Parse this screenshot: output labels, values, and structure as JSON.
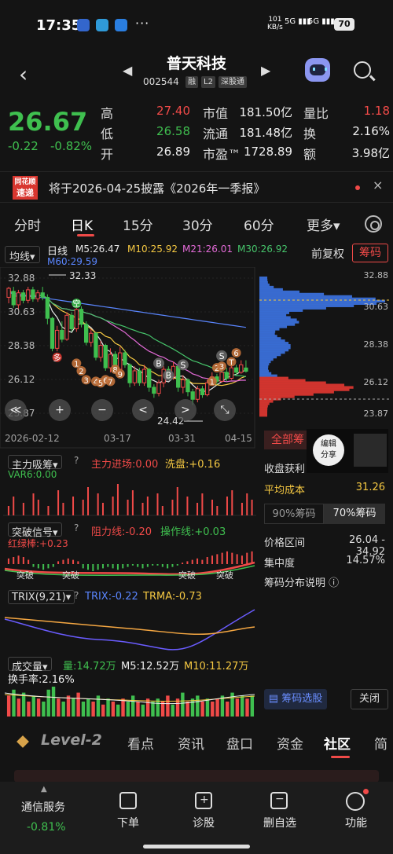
{
  "status_bar": {
    "time": "17:35",
    "dots": "···",
    "net_speed": "101",
    "net_unit": "KB/s",
    "sig1": "5G",
    "sig2": "5G",
    "battery": "70"
  },
  "header": {
    "name": "普天科技",
    "code": "002544",
    "tags": [
      "融",
      "L2",
      "深股通"
    ]
  },
  "quote": {
    "price": "26.67",
    "change": "-0.22",
    "change_pct": "-0.82%",
    "rows": [
      {
        "label1": "高",
        "value1": "27.40",
        "label2": "市值",
        "value2": "181.50亿",
        "label3": "量比",
        "value3": "1.18"
      },
      {
        "label1": "低",
        "value1": "26.58",
        "label2": "流通",
        "value2": "181.48亿",
        "label3": "换",
        "value3": "2.16%"
      },
      {
        "label1": "开",
        "value1": "26.89",
        "label2": "市盈™",
        "value2": "1728.89",
        "label3": "额",
        "value3": "3.98亿"
      }
    ]
  },
  "banner": {
    "logo_line1": "同花顺",
    "logo_line2": "速递",
    "text": "将于2026-04-25披露《2026年一季报》",
    "close": "×"
  },
  "tabs": [
    "分时",
    "日K",
    "15分",
    "30分",
    "60分",
    "更多▾"
  ],
  "chart_header": {
    "select": "均线▾",
    "period": "日线",
    "ma5": "M5:26.47",
    "ma10": "M10:25.92",
    "ma21": "M21:26.01",
    "ma30": "M30:26.92",
    "ma60": "M60:29.59",
    "fq_button": "前复权",
    "chip_button": "筹码"
  },
  "colors": {
    "up": "#f04a48",
    "down": "#3fbf4f",
    "ma5": "#e8e8e8",
    "ma10": "#f5c842",
    "ma21": "#e46bd8",
    "ma30": "#46c46b",
    "ma60": "#5a86ff"
  },
  "chart_data": {
    "type": "candlestick",
    "yticks": [
      "32.88",
      "30.63",
      "28.38",
      "26.12",
      "23.87"
    ],
    "ylim": [
      23.87,
      32.88
    ],
    "x_labels": [
      "2026-02-12",
      "03-17",
      "03-31",
      "04-15"
    ],
    "high_annotation": "32.33",
    "low_annotation": "24.42",
    "candles": [
      [
        31.6,
        32.2,
        31.2,
        32.3
      ],
      [
        32.0,
        31.1,
        30.9,
        32.3
      ],
      [
        31.1,
        31.9,
        30.8,
        32.1
      ],
      [
        31.9,
        31.4,
        31.2,
        32.1
      ],
      [
        31.4,
        32.1,
        31.2,
        32.3
      ],
      [
        32.1,
        31.5,
        31.3,
        32.3
      ],
      [
        31.5,
        31.9,
        31.3,
        32.1
      ],
      [
        31.9,
        31.6,
        31.4,
        32.3
      ],
      [
        31.6,
        30.2,
        29.8,
        31.8
      ],
      [
        30.2,
        28.2,
        28.0,
        30.3
      ],
      [
        28.2,
        29.4,
        28.0,
        29.7
      ],
      [
        29.4,
        28.8,
        28.6,
        30.0
      ],
      [
        28.8,
        30.4,
        28.7,
        30.6
      ],
      [
        30.4,
        29.5,
        29.3,
        30.6
      ],
      [
        29.5,
        30.8,
        29.3,
        31.0
      ],
      [
        30.8,
        29.8,
        29.6,
        31.0
      ],
      [
        29.8,
        28.6,
        28.4,
        30.0
      ],
      [
        28.6,
        29.2,
        28.3,
        29.5
      ],
      [
        29.2,
        27.6,
        27.4,
        29.3
      ],
      [
        27.6,
        28.4,
        27.3,
        28.7
      ],
      [
        28.4,
        26.9,
        26.7,
        28.5
      ],
      [
        26.9,
        27.8,
        26.6,
        28.2
      ],
      [
        27.8,
        26.8,
        26.5,
        28.0
      ],
      [
        26.8,
        27.9,
        26.5,
        28.3
      ],
      [
        27.9,
        27.1,
        26.9,
        28.1
      ],
      [
        27.1,
        25.9,
        25.6,
        27.2
      ],
      [
        25.9,
        26.7,
        25.7,
        27.0
      ],
      [
        26.7,
        25.9,
        25.7,
        26.9
      ],
      [
        25.9,
        26.8,
        25.7,
        27.1
      ],
      [
        26.8,
        25.6,
        25.3,
        26.9
      ],
      [
        25.6,
        25.2,
        24.9,
        25.8
      ],
      [
        25.2,
        25.9,
        25.0,
        26.1
      ],
      [
        25.9,
        26.8,
        25.6,
        27.0
      ],
      [
        26.8,
        26.3,
        26.1,
        27.0
      ],
      [
        26.3,
        27.0,
        26.1,
        27.3
      ],
      [
        27.0,
        25.6,
        25.3,
        27.1
      ],
      [
        25.6,
        26.1,
        25.2,
        26.4
      ],
      [
        26.1,
        25.3,
        25.0,
        26.2
      ],
      [
        25.3,
        24.8,
        24.42,
        25.5
      ],
      [
        24.8,
        25.5,
        24.6,
        25.7
      ],
      [
        25.5,
        25.1,
        24.9,
        25.7
      ],
      [
        25.1,
        25.9,
        25.0,
        26.1
      ],
      [
        25.9,
        26.3,
        25.7,
        26.6
      ],
      [
        26.3,
        26.0,
        25.8,
        26.5
      ],
      [
        26.0,
        26.6,
        25.9,
        26.8
      ],
      [
        26.6,
        26.2,
        26.0,
        26.9
      ],
      [
        26.2,
        26.9,
        26.1,
        27.2
      ],
      [
        26.9,
        26.6,
        26.4,
        27.1
      ],
      [
        26.6,
        27.1,
        26.5,
        27.4
      ],
      [
        26.89,
        26.67,
        26.58,
        27.4
      ]
    ],
    "signals": [
      {
        "text": "多",
        "i": 10,
        "price": 27.6
      },
      {
        "text": "空",
        "i": 14,
        "price": 31.2
      },
      {
        "text": "1",
        "i": 14,
        "price": 27.2
      },
      {
        "text": "2",
        "i": 15,
        "price": 26.7
      },
      {
        "text": "3",
        "i": 16,
        "price": 26.1
      },
      {
        "text": "4",
        "i": 18,
        "price": 26.0
      },
      {
        "text": "5",
        "i": 19,
        "price": 25.9
      },
      {
        "text": "6",
        "i": 20,
        "price": 26.1
      },
      {
        "text": "7",
        "i": 21,
        "price": 26.0
      },
      {
        "text": "8",
        "i": 22,
        "price": 26.8
      },
      {
        "text": "9",
        "i": 23,
        "price": 26.5
      },
      {
        "text": "B",
        "i": 31,
        "price": 27.2
      },
      {
        "text": "B",
        "i": 33,
        "price": 26.4
      },
      {
        "text": "S",
        "i": 36,
        "price": 27.1
      },
      {
        "text": "1",
        "i": 42,
        "price": 26.0
      },
      {
        "text": "2",
        "i": 43,
        "price": 26.9
      },
      {
        "text": "3",
        "i": 44,
        "price": 27.0
      },
      {
        "text": "T",
        "i": 46,
        "price": 27.3
      },
      {
        "text": "6",
        "i": 47,
        "price": 27.9
      },
      {
        "text": "S",
        "i": 44,
        "price": 27.7
      }
    ],
    "chip_yticks": [
      "32.88",
      "30.63",
      "28.38",
      "26.12",
      "23.87"
    ]
  },
  "chart_controls": [
    "≪",
    "+",
    "−",
    "<",
    ">",
    "⤡"
  ],
  "panels": {
    "zlxs": {
      "name": "主力吸筹▾",
      "help": "?",
      "v1": "主力进场:0.00",
      "v2": "洗盘:+0.16",
      "v3": "VAR6:0.00",
      "bars": [
        0.3,
        0.6,
        0,
        0.4,
        0,
        0.7,
        0.5,
        0,
        0.3,
        0,
        0.8,
        0.4,
        0,
        0.6,
        0,
        0.5,
        0.9,
        0,
        0.7,
        0.4,
        0,
        0.6,
        1.0,
        0,
        0.5,
        0.8,
        0,
        0.4,
        0.6,
        0,
        0.7,
        0.3,
        0,
        0.5,
        0.9,
        0,
        0.6,
        0,
        0.4,
        0.7,
        0,
        0.5,
        0.3,
        0,
        0.6,
        0.8,
        0,
        0.4,
        0.7,
        0.5
      ]
    },
    "tpxh": {
      "name": "突破信号▾",
      "help": "?",
      "v1": "阻力线:-0.20",
      "v2": "操作线:+0.03",
      "v3": "红绿棒:+0.23",
      "labels": [
        "突破",
        "突破",
        "突破",
        "突破"
      ],
      "bars": [
        0.4,
        0.5,
        0.6,
        0.5,
        0.3,
        -0.2,
        -0.3,
        -0.4,
        -0.3,
        -0.2,
        0.2,
        0.3,
        0.4,
        0.3,
        0.2,
        -0.3,
        -0.4,
        -0.5,
        -0.4,
        -0.3,
        -0.2,
        -0.3,
        -0.4,
        -0.3,
        -0.2,
        -0.1,
        -0.2,
        -0.3,
        -0.2,
        -0.1,
        -0.1,
        -0.2,
        -0.3,
        -0.2,
        -0.1,
        0.1,
        0.2,
        0.3,
        0.4,
        0.3,
        0.5,
        0.6,
        0.7,
        0.8,
        0.9,
        0.8,
        0.7,
        0.6,
        0.8,
        0.9
      ]
    },
    "trix": {
      "name": "TRIX(9,21)▾",
      "help": "?",
      "v1": "TRIX:-0.22",
      "v2": "TRMA:-0.73"
    },
    "vol": {
      "name": "成交量▾",
      "v1": "量:14.72万",
      "v2": "M5:12.52万",
      "v3": "M10:11.27万",
      "v4": "换手率:2.16%",
      "bars": [
        0.7,
        0.9,
        0.6,
        0.8,
        0.5,
        0.7,
        0.6,
        0.5,
        0.9,
        1.0,
        0.6,
        0.5,
        0.7,
        0.6,
        0.8,
        0.5,
        0.6,
        0.5,
        0.7,
        0.4,
        0.6,
        0.5,
        0.4,
        0.6,
        0.5,
        0.7,
        0.5,
        0.4,
        0.6,
        0.5,
        0.6,
        0.5,
        0.7,
        0.4,
        0.6,
        0.8,
        0.5,
        0.6,
        0.7,
        0.5,
        0.6,
        0.5,
        0.6,
        0.7,
        0.5,
        0.8,
        0.6,
        0.7,
        0.6,
        0.7
      ]
    }
  },
  "side_panel": {
    "tab_all": "全部筹",
    "share": "编辑\n分享",
    "ratio_label": "收盘获利",
    "avg_cost_label": "平均成本",
    "avg_cost": "31.26",
    "seg1": "90%筹码",
    "seg2": "70%筹码",
    "range_label": "价格区间",
    "range_value": "26.04 - 34.92",
    "conc_label": "集中度",
    "conc_value": "14.57%",
    "desc": "筹码分布说明",
    "select_button": "筹码选股",
    "close_button": "关闭"
  },
  "level2_tabs": [
    "Level-2",
    "看点",
    "资讯",
    "盘口",
    "资金",
    "社区",
    "简"
  ],
  "bottom_nav": {
    "stock_name": "通信服务",
    "stock_change": "-0.81%",
    "items": [
      "下单",
      "诊股",
      "删自选",
      "功能"
    ]
  }
}
